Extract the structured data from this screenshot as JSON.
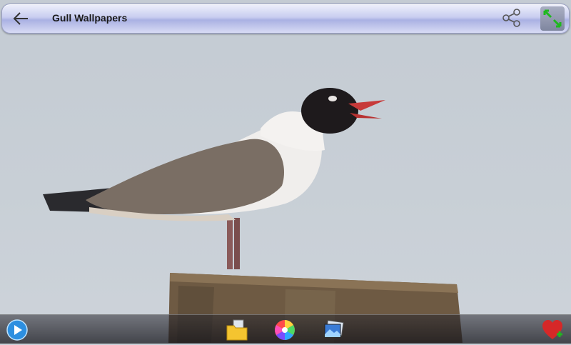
{
  "header": {
    "title": "Gull Wallpapers"
  },
  "icons": {
    "back": "back-arrow-icon",
    "share": "share-icon",
    "fit": "fit-screen-icon",
    "slideshow": "play-icon",
    "folder": "folder-icon",
    "color": "color-wheel-icon",
    "gallery": "gallery-icon",
    "favorite": "heart-add-icon"
  },
  "colors": {
    "topbar": "#c9cdf0",
    "favorite": "#d62828",
    "fit_arrows": "#1fb81f"
  }
}
